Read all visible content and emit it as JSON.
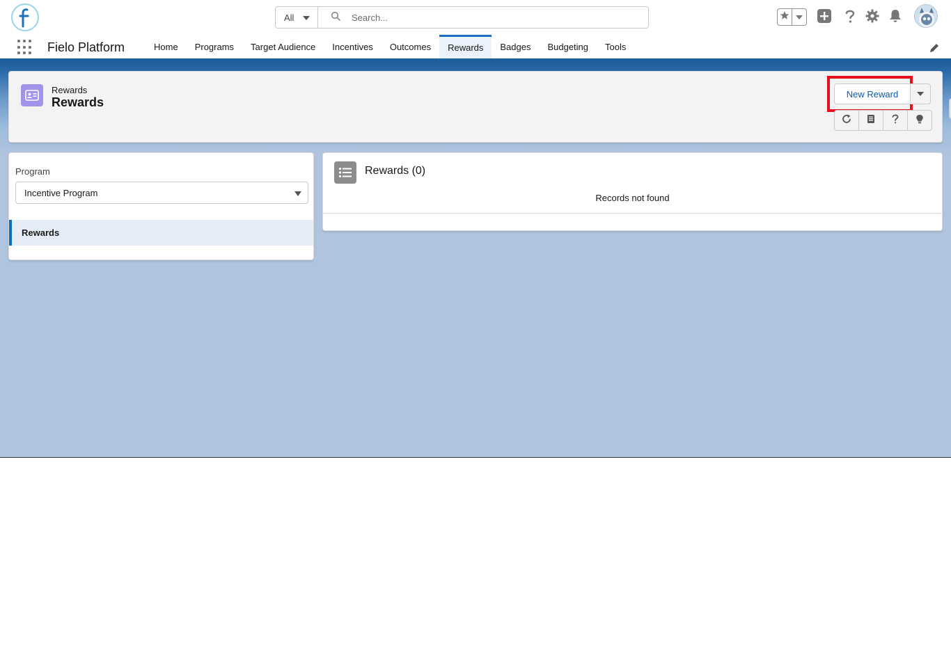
{
  "header": {
    "search_scope": "All",
    "search_placeholder": "Search..."
  },
  "nav": {
    "app_name": "Fielo Platform",
    "items": [
      {
        "label": "Home",
        "active": false
      },
      {
        "label": "Programs",
        "active": false
      },
      {
        "label": "Target Audience",
        "active": false
      },
      {
        "label": "Incentives",
        "active": false
      },
      {
        "label": "Outcomes",
        "active": false
      },
      {
        "label": "Rewards",
        "active": true
      },
      {
        "label": "Badges",
        "active": false
      },
      {
        "label": "Budgeting",
        "active": false
      },
      {
        "label": "Tools",
        "active": false
      }
    ]
  },
  "page_header": {
    "object_label": "Rewards",
    "title": "Rewards",
    "new_button": "New Reward"
  },
  "left_panel": {
    "program_label": "Program",
    "program_value": "Incentive Program",
    "list_item": "Rewards"
  },
  "list_card": {
    "title": "Rewards (0)",
    "empty_message": "Records not found"
  },
  "colors": {
    "accent": "#1b6ec2",
    "highlight": "#e4101e",
    "object_icon": "#a094ed"
  }
}
